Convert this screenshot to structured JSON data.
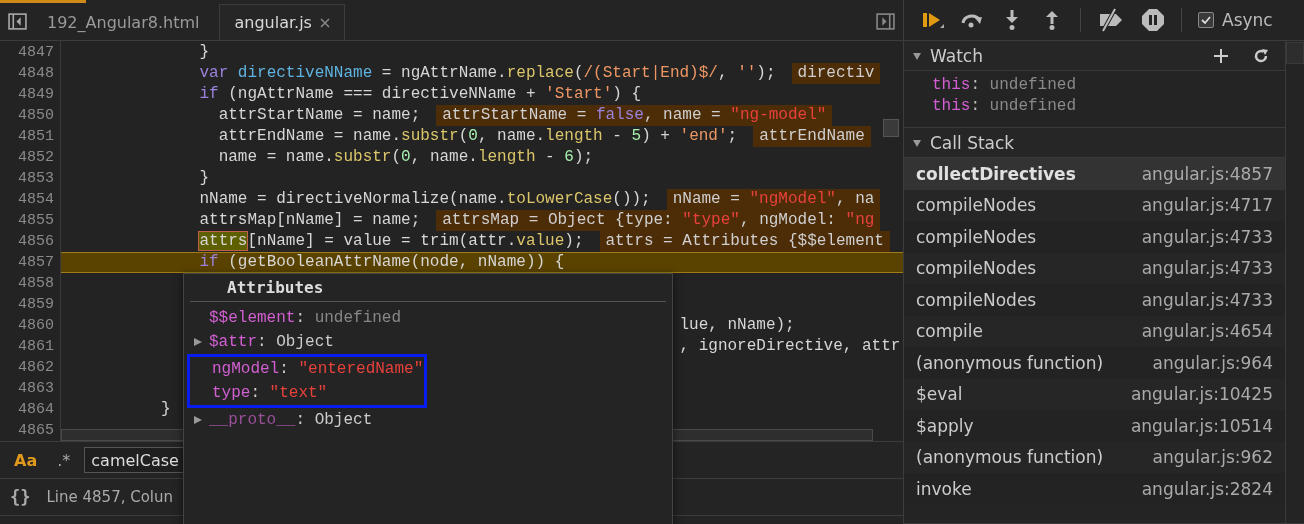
{
  "editor": {
    "tabs": [
      {
        "label": "192_Angular8.html",
        "selected": false,
        "closable": false
      },
      {
        "label": "angular.js",
        "selected": true,
        "closable": true
      }
    ],
    "lines": [
      {
        "number": "4847",
        "current": false,
        "code": [
          {
            "kind": "plain",
            "t": "              }"
          }
        ]
      },
      {
        "number": "4848",
        "current": false,
        "code": [
          {
            "kind": "keyword",
            "t": "              var "
          },
          {
            "kind": "def",
            "t": "directiveNName"
          },
          {
            "kind": "plain",
            "t": " = ngAttrName."
          },
          {
            "kind": "prop",
            "t": "replace"
          },
          {
            "kind": "plain",
            "t": "("
          },
          {
            "kind": "str",
            "t": "/(Start|End)$/"
          },
          {
            "kind": "plain",
            "t": ", "
          },
          {
            "kind": "str",
            "t": "''"
          },
          {
            "kind": "plain",
            "t": ");"
          }
        ],
        "value": [
          {
            "kind": "plain",
            "t": "directiv"
          }
        ]
      },
      {
        "number": "4849",
        "current": false,
        "code": [
          {
            "kind": "keyword",
            "t": "              if"
          },
          {
            "kind": "plain",
            "t": " (ngAttrName === directiveNName + "
          },
          {
            "kind": "str",
            "t": "'Start'"
          },
          {
            "kind": "plain",
            "t": ") {"
          }
        ]
      },
      {
        "number": "4850",
        "current": false,
        "code": [
          {
            "kind": "plain",
            "t": "                attrStartName = name;"
          }
        ],
        "value": [
          {
            "kind": "plain",
            "t": "attrStartName = "
          },
          {
            "kind": "keyword",
            "t": "false"
          },
          {
            "kind": "plain",
            "t": ", name = "
          },
          {
            "kind": "val",
            "t": "\"ng-model\""
          }
        ]
      },
      {
        "number": "4851",
        "current": false,
        "code": [
          {
            "kind": "plain",
            "t": "                attrEndName = name."
          },
          {
            "kind": "prop",
            "t": "substr"
          },
          {
            "kind": "plain",
            "t": "("
          },
          {
            "kind": "num",
            "t": "0"
          },
          {
            "kind": "plain",
            "t": ", name."
          },
          {
            "kind": "prop",
            "t": "length"
          },
          {
            "kind": "plain",
            "t": " - "
          },
          {
            "kind": "num",
            "t": "5"
          },
          {
            "kind": "plain",
            "t": ") + "
          },
          {
            "kind": "str",
            "t": "'end'"
          },
          {
            "kind": "plain",
            "t": ";"
          }
        ],
        "value": [
          {
            "kind": "plain",
            "t": "attrEndName"
          }
        ]
      },
      {
        "number": "4852",
        "current": false,
        "code": [
          {
            "kind": "plain",
            "t": "                name = name."
          },
          {
            "kind": "prop",
            "t": "substr"
          },
          {
            "kind": "plain",
            "t": "("
          },
          {
            "kind": "num",
            "t": "0"
          },
          {
            "kind": "plain",
            "t": ", name."
          },
          {
            "kind": "prop",
            "t": "length"
          },
          {
            "kind": "plain",
            "t": " - "
          },
          {
            "kind": "num",
            "t": "6"
          },
          {
            "kind": "plain",
            "t": ");"
          }
        ]
      },
      {
        "number": "4853",
        "current": false,
        "code": [
          {
            "kind": "plain",
            "t": "              }"
          }
        ]
      },
      {
        "number": "4854",
        "current": false,
        "code": [
          {
            "kind": "plain",
            "t": "              nName = directiveNormalize(name."
          },
          {
            "kind": "prop",
            "t": "toLowerCase"
          },
          {
            "kind": "plain",
            "t": "());"
          }
        ],
        "value": [
          {
            "kind": "plain",
            "t": "nName = "
          },
          {
            "kind": "val",
            "t": "\"ngModel\""
          },
          {
            "kind": "plain",
            "t": ", na"
          }
        ]
      },
      {
        "number": "4855",
        "current": false,
        "code": [
          {
            "kind": "plain",
            "t": "              attrsMap[nName] = name;"
          }
        ],
        "value": [
          {
            "kind": "plain",
            "t": "attrsMap = Object {type: "
          },
          {
            "kind": "val",
            "t": "\"type\""
          },
          {
            "kind": "plain",
            "t": ", ngModel: "
          },
          {
            "kind": "val",
            "t": "\"ng"
          }
        ]
      },
      {
        "number": "4856",
        "current": false,
        "code": [
          {
            "kind": "hover",
            "t": "              attrs"
          },
          {
            "kind": "plain",
            "t": "[nName] = value = trim(attr."
          },
          {
            "kind": "prop",
            "t": "value"
          },
          {
            "kind": "plain",
            "t": ");"
          }
        ],
        "value": [
          {
            "kind": "plain",
            "t": "attrs = Attributes {$$element"
          }
        ]
      },
      {
        "number": "4857",
        "current": true,
        "code": [
          {
            "kind": "keyword",
            "t": "              if"
          },
          {
            "kind": "plain",
            "t": " (getBooleanAttrName(node, nName)) {"
          }
        ]
      },
      {
        "number": "4858",
        "current": false
      },
      {
        "number": "4859",
        "current": false
      },
      {
        "number": "4860",
        "current": false,
        "code": [
          {
            "kind": "plain",
            "t": "                                                                lue, nName);"
          }
        ]
      },
      {
        "number": "4861",
        "current": false,
        "code": [
          {
            "kind": "plain",
            "t": "                                                                , ignoreDirective, attr"
          }
        ]
      },
      {
        "number": "4862",
        "current": false
      },
      {
        "number": "4863",
        "current": false
      },
      {
        "number": "4864",
        "current": false,
        "code": [
          {
            "kind": "plain",
            "t": "          }"
          }
        ]
      },
      {
        "number": "4865",
        "current": false
      }
    ],
    "search": {
      "match_case": {
        "label": "Aa",
        "on": true
      },
      "regex": {
        "label": ".*",
        "on": false
      },
      "value": "camelCase"
    },
    "status": {
      "format_button": "{}",
      "position": "Line 4857, Colun"
    }
  },
  "popover": {
    "title": "Attributes",
    "properties": [
      {
        "name": "$$element",
        "separator": ":",
        "value": "undefined",
        "kind": "undefined",
        "expandable": false,
        "dim": false,
        "highlighted": false
      },
      {
        "name": "$attr",
        "separator": ":",
        "value": "Object",
        "kind": "object",
        "expandable": true,
        "dim": false,
        "highlighted": false
      },
      {
        "name": "ngModel",
        "separator": ":",
        "value": "\"enteredName\"",
        "kind": "string",
        "expandable": false,
        "dim": false,
        "highlighted": true
      },
      {
        "name": "type",
        "separator": ":",
        "value": "\"text\"",
        "kind": "string",
        "expandable": false,
        "dim": false,
        "highlighted": true
      },
      {
        "name": "__proto__",
        "separator": ":",
        "value": "Object",
        "kind": "object",
        "expandable": true,
        "dim": true,
        "highlighted": false
      }
    ]
  },
  "debugger": {
    "async": {
      "label": "Async",
      "checked": true
    },
    "watch": {
      "title": "Watch",
      "expanded": true,
      "items": [
        {
          "name": "this",
          "separator": ":",
          "value": "undefined"
        },
        {
          "name": "this",
          "separator": ":",
          "value": "undefined"
        }
      ]
    },
    "call_stack": {
      "title": "Call Stack",
      "expanded": true,
      "frames": [
        {
          "function": "collectDirectives",
          "location": "angular.js:4857",
          "selected": true
        },
        {
          "function": "compileNodes",
          "location": "angular.js:4717",
          "selected": false
        },
        {
          "function": "compileNodes",
          "location": "angular.js:4733",
          "selected": false
        },
        {
          "function": "compileNodes",
          "location": "angular.js:4733",
          "selected": false
        },
        {
          "function": "compileNodes",
          "location": "angular.js:4733",
          "selected": false
        },
        {
          "function": "compile",
          "location": "angular.js:4654",
          "selected": false
        },
        {
          "function": "(anonymous function)",
          "location": "angular.js:964",
          "selected": false
        },
        {
          "function": "$eval",
          "location": "angular.js:10425",
          "selected": false
        },
        {
          "function": "$apply",
          "location": "angular.js:10514",
          "selected": false
        },
        {
          "function": "(anonymous function)",
          "location": "angular.js:962",
          "selected": false
        },
        {
          "function": "invoke",
          "location": "angular.js:2824",
          "selected": false
        }
      ]
    }
  }
}
